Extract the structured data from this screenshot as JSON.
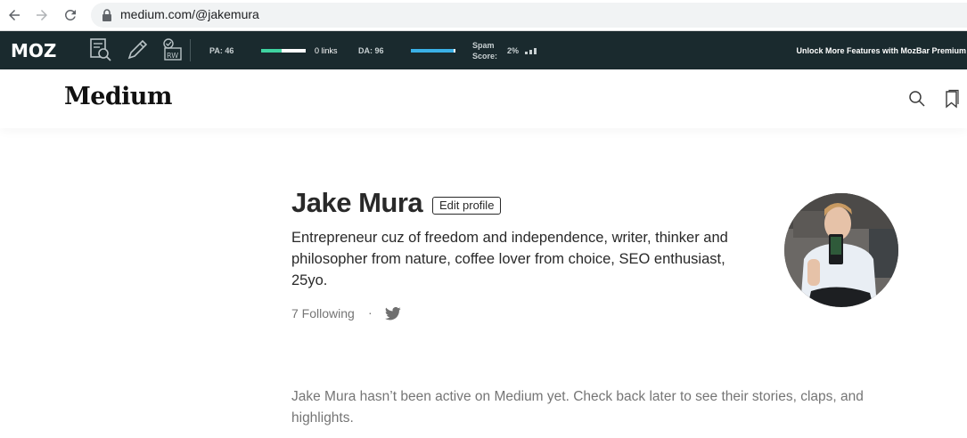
{
  "browser": {
    "url": "medium.com/@jakemura"
  },
  "mozbar": {
    "logo": "MOZ",
    "pa_label": "PA: 46",
    "pa_bar_fraction": 0.46,
    "links_label": "0 links",
    "da_label": "DA: 96",
    "da_bar_fraction": 0.96,
    "spam_label_line1": "Spam",
    "spam_label_line2": "Score:",
    "spam_value": "2%",
    "unlock_text": "Unlock More Features with MozBar Premium",
    "pa_bar_color": "#3fd3a0",
    "da_bar_color": "#3ab0e6",
    "background_color": "#1a2a2e"
  },
  "medium_header": {
    "logo": "Medium",
    "icons": [
      "search-icon",
      "bookmark-icon"
    ]
  },
  "profile": {
    "name": "Jake Mura",
    "edit_button": "Edit profile",
    "bio": "Entrepreneur cuz of freedom and independence, writer, thinker and philosopher from nature, coffee lover from choice, SEO enthusiast, 25yo.",
    "following": "7 Following",
    "separator": "·",
    "inactive_message": "Jake Mura hasn’t been active on Medium yet. Check back later to see their stories, claps, and highlights."
  }
}
